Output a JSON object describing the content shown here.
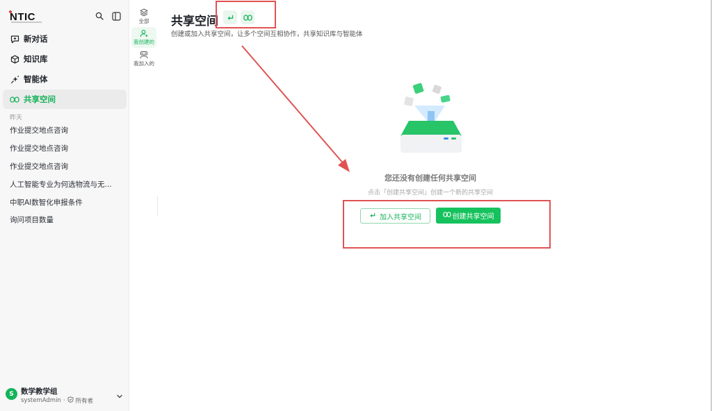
{
  "brand": {
    "name": "NTIC"
  },
  "nav": {
    "items": [
      {
        "label": "新对话",
        "icon": "new-chat-icon"
      },
      {
        "label": "知识库",
        "icon": "cube-icon"
      },
      {
        "label": "智能体",
        "icon": "sparkle-icon"
      },
      {
        "label": "共享空间",
        "icon": "infinity-icon",
        "active": true
      }
    ]
  },
  "history": {
    "label": "昨天",
    "items": [
      "作业提交地点咨询",
      "作业提交地点咨询",
      "作业提交地点咨询",
      "人工智能专业为何选物流与无...",
      "中职AI数智化申报条件",
      "询问项目数量"
    ]
  },
  "user": {
    "avatar_letter": "S",
    "name": "数学教学组",
    "account": "systemAdmin",
    "role": "所有者"
  },
  "filters": {
    "items": [
      {
        "label": "全部",
        "icon": "layers-icon"
      },
      {
        "label": "我创建的",
        "icon": "user-icon",
        "active": true
      },
      {
        "label": "我加入的",
        "icon": "group-icon"
      }
    ]
  },
  "main": {
    "title": "共享空间",
    "description": "创建或加入共享空间，让多个空间互相协作，共享知识库与智能体"
  },
  "empty": {
    "title": "您还没有创建任何共享空间",
    "description": "点击「创建共享空间」创建一个新的共享空间",
    "join_label": "加入共享空间",
    "create_label": "创建共享空间"
  },
  "colors": {
    "accent": "#16c25d",
    "accent_text": "#16b35a",
    "annotation": "#e05252"
  }
}
